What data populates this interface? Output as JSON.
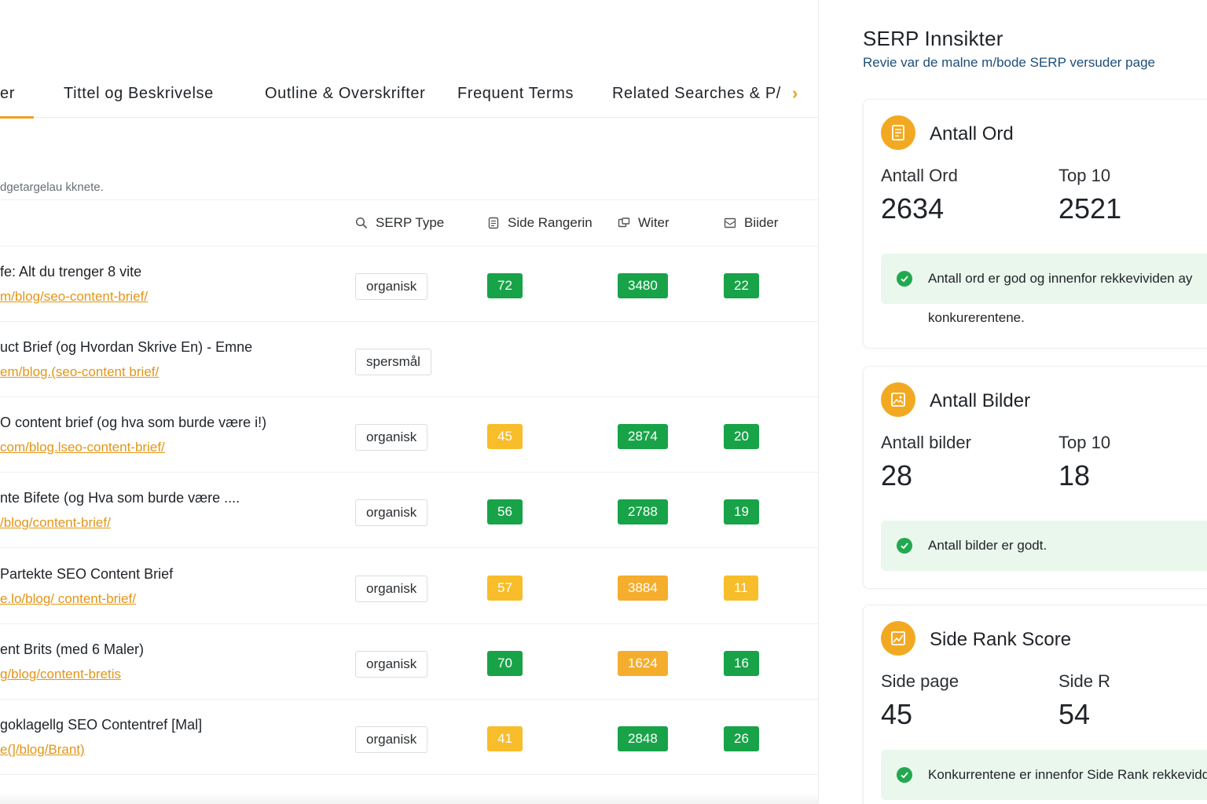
{
  "tabs": {
    "items": [
      {
        "label": "er",
        "active": true
      },
      {
        "label": "Tittel og Beskrivelse"
      },
      {
        "label": "Outline & Overskrifter"
      },
      {
        "label": "Frequent Terms"
      },
      {
        "label": "Related Searches & P/"
      }
    ],
    "next_icon": "chevron-right-icon"
  },
  "table": {
    "subtitle": "dgetargelau kknete.",
    "headers": {
      "serp_type": "SERP Type",
      "side_rangering": "Side Rangerin",
      "witer": "Witer",
      "bilder": "Biider"
    },
    "rows": [
      {
        "title": "fe: Alt du trenger 8 vite",
        "url": "m/blog/seo-content-brief/",
        "type": "organisk",
        "rank": {
          "value": "72",
          "color": "green"
        },
        "words": {
          "value": "3480",
          "color": "green"
        },
        "images": {
          "value": "22",
          "color": "green"
        }
      },
      {
        "title": "uct Brief (og Hvordan Skrive En) - Emne",
        "url": "em/blog.(seo-content brief/",
        "type": "spersmål"
      },
      {
        "title": "O content brief (og hva som burde være i!)",
        "url": "com/blog.lseo-content-brief/",
        "type": "organisk",
        "rank": {
          "value": "45",
          "color": "yellow"
        },
        "words": {
          "value": "2874",
          "color": "green"
        },
        "images": {
          "value": "20",
          "color": "green"
        }
      },
      {
        "title": "nte Bifete (og Hva som burde være ....",
        "url": "/blog/content-brief/",
        "type": "organisk",
        "rank": {
          "value": "56",
          "color": "green"
        },
        "words": {
          "value": "2788",
          "color": "green"
        },
        "images": {
          "value": "19",
          "color": "green"
        }
      },
      {
        "title": "Partekte SEO Content Brief",
        "url": "e.lo/blog/ content-brief/",
        "type": "organisk",
        "rank": {
          "value": "57",
          "color": "yellow"
        },
        "words": {
          "value": "3884",
          "color": "orange"
        },
        "images": {
          "value": "11",
          "color": "yellow"
        }
      },
      {
        "title": "ent Brits (med 6 Maler)",
        "url": "g/blog/content-bretis",
        "type": "organisk",
        "rank": {
          "value": "70",
          "color": "green"
        },
        "words": {
          "value": "1624",
          "color": "orange"
        },
        "images": {
          "value": "16",
          "color": "green"
        }
      },
      {
        "title": "goklagellg SEO Contentref [Mal]",
        "url": "e(]/blog/Brant)",
        "type": "organisk",
        "rank": {
          "value": "41",
          "color": "yellow"
        },
        "words": {
          "value": "2848",
          "color": "green"
        },
        "images": {
          "value": "26",
          "color": "green"
        }
      }
    ]
  },
  "insights": {
    "title": "SERP Innsikter",
    "subtitle": "Revie var de malne m/bode SERP versuder page",
    "cards": [
      {
        "icon": "document-icon",
        "title": "Antall Ord",
        "left_label": "Antall Ord",
        "left_value": "2634",
        "right_label": "Top 10",
        "right_value": "2521",
        "note_line1": "Antall ord er god og innenfor rekkevividen ay",
        "note_line2": "konkurerentene."
      },
      {
        "icon": "image-icon",
        "title": "Antall Bilder",
        "left_label": "Antall bilder",
        "left_value": "28",
        "right_label": "Top 10",
        "right_value": "18",
        "note_line1": "Antall bilder er godt."
      },
      {
        "icon": "rank-icon",
        "title": "Side Rank Score",
        "left_label": "Side page",
        "left_value": "45",
        "right_label": "Side R",
        "right_value": "54",
        "note_line1": "Konkurrentene er innenfor Side Rank rekkevidd"
      }
    ]
  },
  "colors": {
    "accent": "#f0a020",
    "green": "#18a348",
    "yellow": "#f7bd2a",
    "orange": "#f5ad2d"
  }
}
